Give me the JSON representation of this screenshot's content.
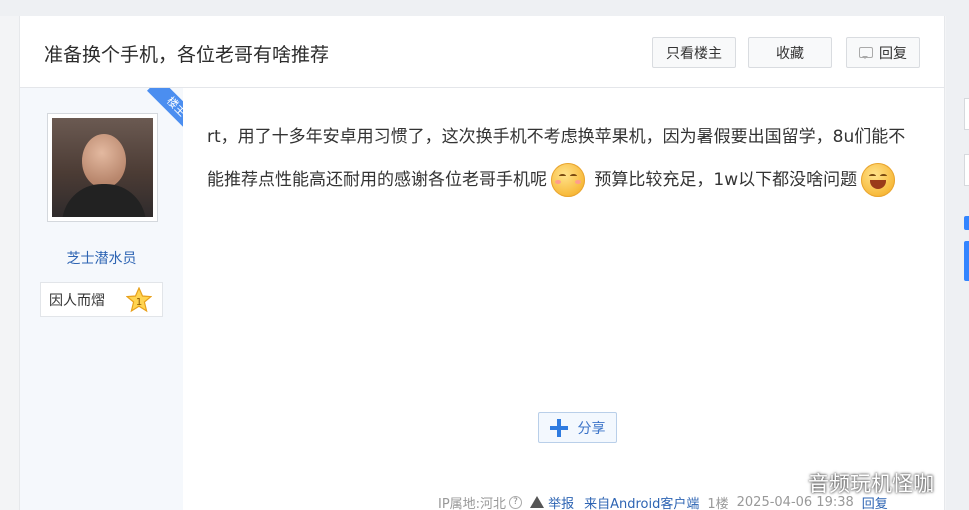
{
  "thread": {
    "title": "准备换个手机，各位老哥有啥推荐",
    "only_op_label": "只看楼主",
    "favorite_label": "收藏",
    "reply_label": "回复"
  },
  "author": {
    "badge": "楼主",
    "username": "芝士潜水员",
    "level_name": "因人而熠",
    "level_number": "1"
  },
  "post": {
    "text_1": "rt，用了十多年安卓用习惯了，这次换手机不考虑换苹果机，因为暑假要出国留学，8u们能不能推荐点性能高还耐用的感谢各位老哥手机呢",
    "text_2": " 预算比较充足，1w以下都没啥问题",
    "emoji_1": "smile-emoji",
    "emoji_2": "grin-emoji"
  },
  "share": {
    "label": "分享"
  },
  "footer": {
    "ip": "IP属地:河北",
    "help_symbol": "?",
    "report_label": "举报",
    "source": "来自Android客户端",
    "floor": "1楼",
    "time": "2025-04-06 19:38",
    "reply_label": "回复"
  },
  "watermark": "音频玩机怪咖",
  "colors": {
    "link": "#2d64b3",
    "accent": "#3385ff",
    "ribbon": "#4b8ef0"
  }
}
